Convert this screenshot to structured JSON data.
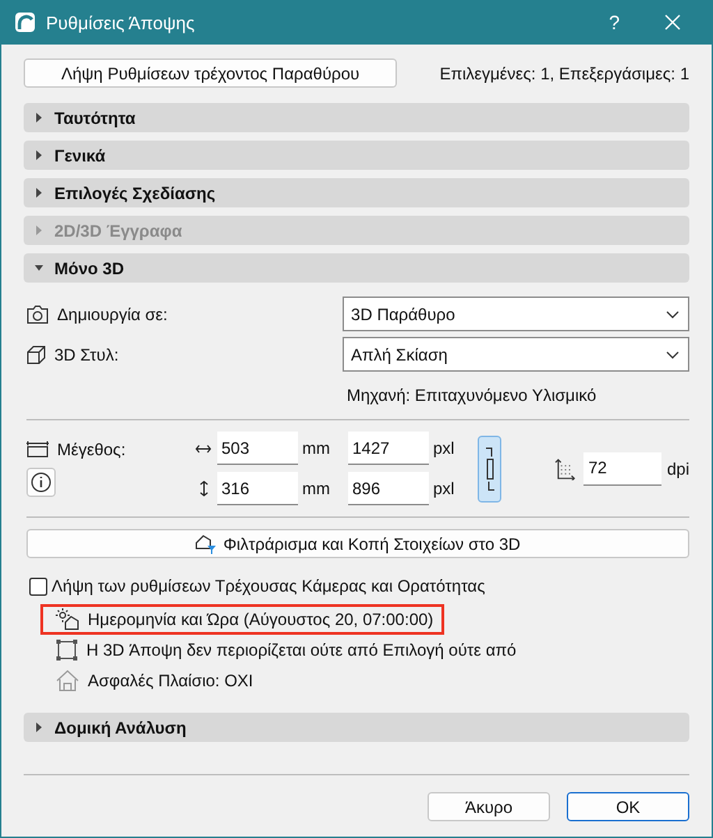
{
  "window": {
    "title": "Ρυθμίσεις Άποψης",
    "help": "?"
  },
  "top_button": "Λήψη Ρυθμίσεων τρέχοντος Παραθύρου",
  "selection_info": "Επιλεγμένες: 1, Επεξεργάσιμες: 1",
  "sections": [
    {
      "label": "Ταυτότητα",
      "expanded": false,
      "disabled": false
    },
    {
      "label": "Γενικά",
      "expanded": false,
      "disabled": false
    },
    {
      "label": "Επιλογές Σχεδίασης",
      "expanded": false,
      "disabled": false
    },
    {
      "label": "2D/3D Έγγραφα",
      "expanded": false,
      "disabled": true
    },
    {
      "label": "Μόνο 3D",
      "expanded": true,
      "disabled": false,
      "kind": "only3d"
    },
    {
      "label": "Δομική Ανάλυση",
      "expanded": false,
      "disabled": false
    }
  ],
  "only3d": {
    "create_in": {
      "label": "Δημιουργία σε:",
      "value": "3D Παράθυρο"
    },
    "style": {
      "label": "3D Στυλ:",
      "value": "Απλή Σκίαση"
    },
    "engine": "Μηχανή: Επιταχυνόμενο Υλισμικό",
    "size": {
      "label": "Μέγεθος:",
      "linked": true,
      "dpi": "72",
      "dpi_unit": "dpi",
      "rows": [
        {
          "kind": "horizontal",
          "mm": "503",
          "mm_unit": "mm",
          "px": "1427",
          "px_unit": "pxl"
        },
        {
          "kind": "vertical",
          "mm": "316",
          "mm_unit": "mm",
          "px": "896",
          "px_unit": "pxl"
        }
      ]
    },
    "filter_button": "Φιλτράρισμα και Κοπή Στοιχείων στο 3D",
    "checkbox": {
      "label": "Λήψη των ρυθμίσεων Τρέχουσας Κάμερας και Ορατότητας",
      "checked": false
    },
    "info_rows": [
      {
        "kind": "sun",
        "text": "Ημερομηνία και Ώρα (Αύγουστος 20, 07:00:00)",
        "highlighted": true
      },
      {
        "kind": "frame",
        "text": "Η 3D Άποψη δεν περιορίζεται ούτε από Επιλογή ούτε από",
        "highlighted": false
      },
      {
        "kind": "house",
        "text": "Ασφαλές Πλαίσιο: ΟΧΙ",
        "highlighted": false
      }
    ]
  },
  "buttons": [
    {
      "label": "Άκυρο",
      "default": false
    },
    {
      "label": "OK",
      "default": true
    }
  ]
}
